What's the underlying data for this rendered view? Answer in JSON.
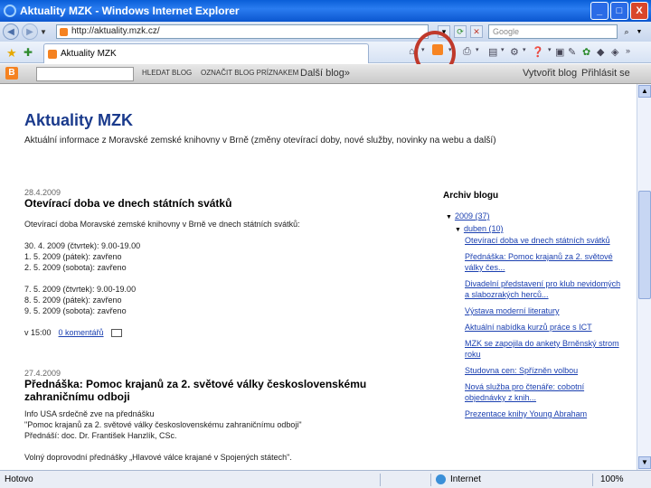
{
  "window": {
    "title": "Aktuality MZK - Windows Internet Explorer",
    "minimize": "_",
    "maximize": "□",
    "close": "X"
  },
  "address": {
    "url": "http://aktuality.mzk.cz/",
    "search_placeholder": "Google"
  },
  "tab": {
    "label": "Aktuality MZK"
  },
  "blogger_nav": {
    "search_blog": "HLEDAT BLOG",
    "flag_blog": "OZNAČIT BLOG PRÍZNAKEM",
    "next_blog": "Další blog»",
    "create_blog": "Vytvořit blog",
    "sign_in": "Přihlásit se"
  },
  "blog": {
    "title": "Aktuality MZK",
    "description": "Aktuální informace z Moravské zemské knihovny v Brně (změny otevírací doby, nové služby, novinky na webu a další)"
  },
  "posts": [
    {
      "date": "28.4.2009",
      "title": "Otevírací doba ve dnech státních svátků",
      "lines": [
        "Otevírací doba Moravské zemské knihovny v Brně ve dnech státních svátků:",
        "",
        "30. 4. 2009 (čtvrtek): 9.00-19.00",
        "1. 5. 2009 (pátek): zavřeno",
        "2. 5. 2009 (sobota): zavřeno",
        "",
        "7. 5. 2009 (čtvrtek): 9.00-19.00",
        "8. 5. 2009 (pátek): zavřeno",
        "9. 5. 2009 (sobota): zavřeno"
      ],
      "footer_prefix": "v 15:00",
      "comments": "0 komentářů"
    },
    {
      "date": "27.4.2009",
      "title": "Přednáška: Pomoc krajanů za 2. světové války československému zahraničnímu odboji",
      "lines": [
        "Info USA srdečně zve na přednášku",
        "\"Pomoc krajanů za 2. světové války československému zahraničnímu odboji\"",
        "Přednáší: doc. Dr. František Hanzlík, CSc.",
        "",
        "Volný doprovodní přednášky „Hlavové válce krajané v Spojených státech\"."
      ]
    }
  ],
  "sidebar": {
    "title": "Archiv blogu",
    "year": "2009 (37)",
    "month": "duben (10)",
    "items": [
      "Otevírací doba ve dnech státních svátků",
      "Přednáška: Pomoc krajanů za 2. světové války čes...",
      "Divadelní představení pro klub nevidomých a slabozrakých herců...",
      "Výstava moderní literatury",
      "Aktuální nabídka kurzů práce s ICT",
      "MZK se zapojila do ankety Brněnský strom roku",
      "Studovna cen: Spřízněn volbou",
      "Nová služba pro čtenáře: cobotní objednávky z knih...",
      "Prezentace knihy Young Abraham"
    ]
  },
  "status": {
    "left": "Hotovo",
    "zone": "Internet",
    "zoom": "100%"
  },
  "colors": {
    "title_blue": "#1a3a8c",
    "link_blue": "#1a3fb0",
    "highlight_red": "#c0392b",
    "rss_orange": "#f78422"
  }
}
